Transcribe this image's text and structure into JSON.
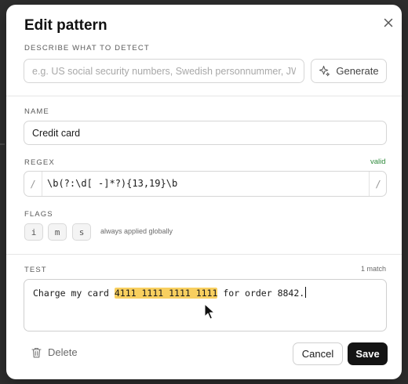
{
  "dialog": {
    "title": "Edit pattern"
  },
  "describe": {
    "label": "DESCRIBE WHAT TO DETECT",
    "placeholder": "e.g. US social security numbers, Swedish personnummer, JWT",
    "value": "",
    "generate_label": "Generate"
  },
  "name": {
    "label": "NAME",
    "value": "Credit card"
  },
  "regex": {
    "label": "REGEX",
    "status": "valid",
    "open_delim": "/",
    "close_delim": "/",
    "value": "\\b(?:\\d[ -]*?){13,19}\\b"
  },
  "flags": {
    "label": "FLAGS",
    "items": [
      "i",
      "m",
      "s"
    ],
    "note": "always applied globally"
  },
  "test": {
    "label": "TEST",
    "match_count": "1 match",
    "text_before": "Charge my card ",
    "text_match": "4111 1111 1111 1111",
    "text_after": " for order 8842."
  },
  "footer": {
    "delete_label": "Delete",
    "cancel_label": "Cancel",
    "save_label": "Save"
  },
  "colors": {
    "highlight": "#f8cf5f",
    "valid": "#2f8a3c",
    "primary": "#141414"
  }
}
